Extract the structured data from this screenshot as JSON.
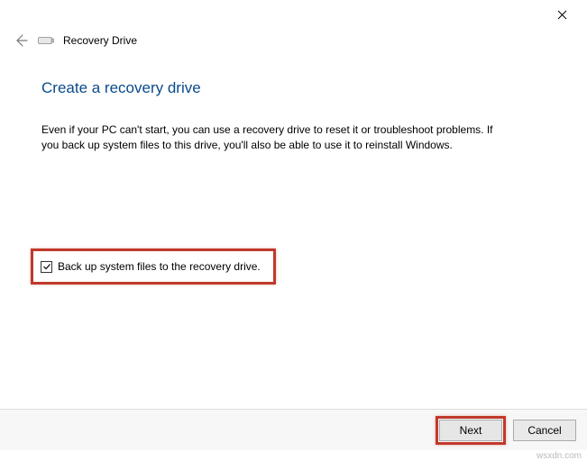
{
  "window": {
    "title": "Recovery Drive"
  },
  "page": {
    "heading": "Create a recovery drive",
    "body": "Even if your PC can't start, you can use a recovery drive to reset it or troubleshoot problems. If you back up system files to this drive, you'll also be able to use it to reinstall Windows."
  },
  "checkbox": {
    "label": "Back up system files to the recovery drive.",
    "checked": true
  },
  "buttons": {
    "next": "Next",
    "cancel": "Cancel"
  },
  "watermark": "wsxdn.com"
}
